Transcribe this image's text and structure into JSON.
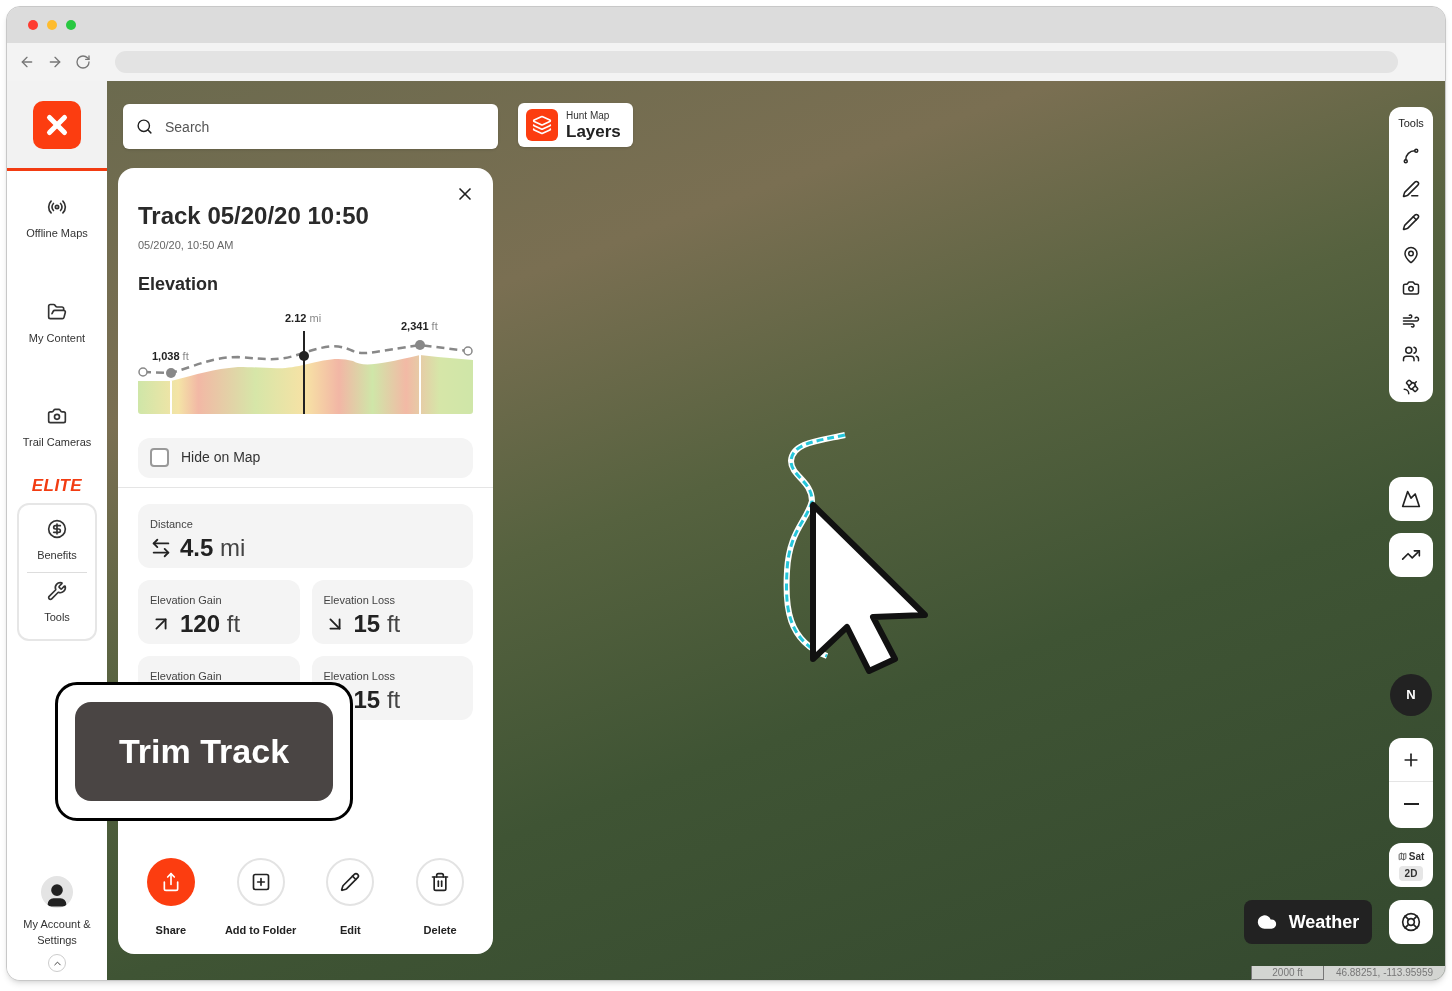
{
  "sidebar": {
    "items": [
      {
        "label": "Offline Maps",
        "kind": "offline"
      },
      {
        "label": "My Content",
        "kind": "content"
      },
      {
        "label": "Trail Cameras",
        "kind": "camera"
      }
    ],
    "elite_label": "ELITE",
    "elite_items": [
      {
        "label": "Benefits",
        "kind": "benefits"
      },
      {
        "label": "Tools",
        "kind": "tools"
      }
    ],
    "account_label": "My Account & Settings"
  },
  "search": {
    "placeholder": "Search"
  },
  "layers_button": {
    "caption": "Hunt Map",
    "label": "Layers"
  },
  "panel": {
    "title": "Track 05/20/20 10:50",
    "subtitle": "05/20/20, 10:50 AM",
    "section": "Elevation",
    "chart_labels": [
      {
        "value": "1,038",
        "unit": "ft",
        "kind": "low"
      },
      {
        "value": "2.12",
        "unit": "mi",
        "kind": "cursor"
      },
      {
        "value": "2,341",
        "unit": "ft",
        "kind": "high"
      }
    ],
    "hide_on_map": {
      "label": "Hide on Map",
      "checked": false
    },
    "stats": [
      {
        "label": "Distance",
        "value": "4.5",
        "unit": "mi",
        "kind": "distance",
        "wide": true
      },
      {
        "label": "Elevation Gain",
        "value": "120",
        "unit": "ft",
        "kind": "gain",
        "wide": false
      },
      {
        "label": "Elevation Loss",
        "value": "15",
        "unit": "ft",
        "kind": "loss",
        "wide": false
      },
      {
        "label": "Elevation Gain",
        "kind": "hidden",
        "wide": false
      },
      {
        "label": "Elevation Loss",
        "value": "15",
        "unit": "ft",
        "kind": "hidden",
        "wide": false
      }
    ],
    "actions": [
      {
        "label": "Share",
        "kind": "share",
        "primary": true
      },
      {
        "label": "Add to Folder",
        "kind": "folder",
        "primary": false
      },
      {
        "label": "Edit",
        "kind": "edit",
        "primary": false
      },
      {
        "label": "Delete",
        "kind": "delete",
        "primary": false
      }
    ]
  },
  "tools": {
    "title": "Tools",
    "items": [
      {
        "kind": "route"
      },
      {
        "kind": "line"
      },
      {
        "kind": "shape"
      },
      {
        "kind": "pin"
      },
      {
        "kind": "camera"
      },
      {
        "kind": "wind"
      },
      {
        "kind": "people"
      },
      {
        "kind": "satellite"
      }
    ],
    "extra": [
      {
        "kind": "terrain"
      },
      {
        "kind": "chart"
      }
    ]
  },
  "compass": {
    "label": "N"
  },
  "map_type": {
    "label": "Sat",
    "mode": "2D"
  },
  "weather_button": {
    "label": "Weather"
  },
  "scale": "2000 ft",
  "coordinates": "46.88251, -113.95959",
  "callout": {
    "label": "Trim Track"
  }
}
